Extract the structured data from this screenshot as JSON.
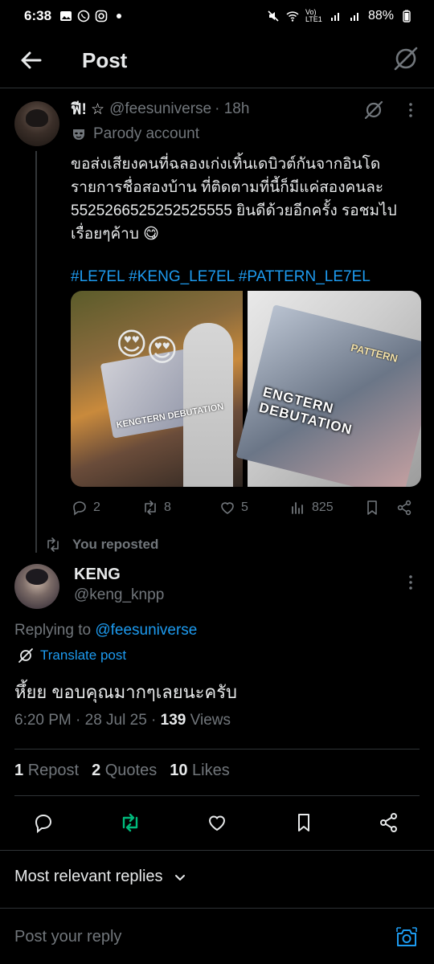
{
  "status_bar": {
    "time": "6:38",
    "network": "Vo) LTE1",
    "battery": "88%"
  },
  "header": {
    "title": "Post"
  },
  "original_post": {
    "display_name": "ฟี! ☆",
    "handle": "@feesuniverse",
    "age": "· 18h",
    "parody_label": "Parody account",
    "text": "ขอส่งเสียงคนที่ฉลองเก่งเทิ้นเดบิวต์กันจากอินโด รายการชื่อสองบ้าน ที่ติดตามที่นี้ก็มีแค่สองคนละ 5525266525252525555 ยินดีด้วยอีกครั้ง รอชมไปเรื่อยๆค้าบ 😋",
    "hashtags": "#LE7EL #KENG_LE7EL #PATTERN_LE7EL",
    "media": {
      "image1_banner_text": "KENGTERN DEBUTATION",
      "image2_banner_text": "ENGTERN DEBUTATION",
      "image2_poster_text": "PATTERN"
    },
    "stats": {
      "replies": "2",
      "reposts": "8",
      "likes": "5",
      "views": "825"
    }
  },
  "repost_label": "You reposted",
  "reply_post": {
    "display_name": "KENG",
    "handle": "@keng_knpp",
    "replying_prefix": "Replying to ",
    "replying_to": "@feesuniverse",
    "translate_label": "Translate post",
    "text": "หึ้ยย ขอบคุณมากๆเลยนะครับ",
    "time": "6:20 PM · 28 Jul 25 · ",
    "views_count": "139",
    "views_label": " Views",
    "stats": {
      "reposts_count": "1",
      "reposts_label": "Repost",
      "quotes_count": "2",
      "quotes_label": "Quotes",
      "likes_count": "10",
      "likes_label": "Likes"
    }
  },
  "sort": {
    "label": "Most relevant replies"
  },
  "composer": {
    "placeholder": "Post your reply"
  },
  "colors": {
    "accent": "#1d9bf0",
    "repost_green": "#00ba7c",
    "muted": "#71767b",
    "background": "#000000"
  }
}
